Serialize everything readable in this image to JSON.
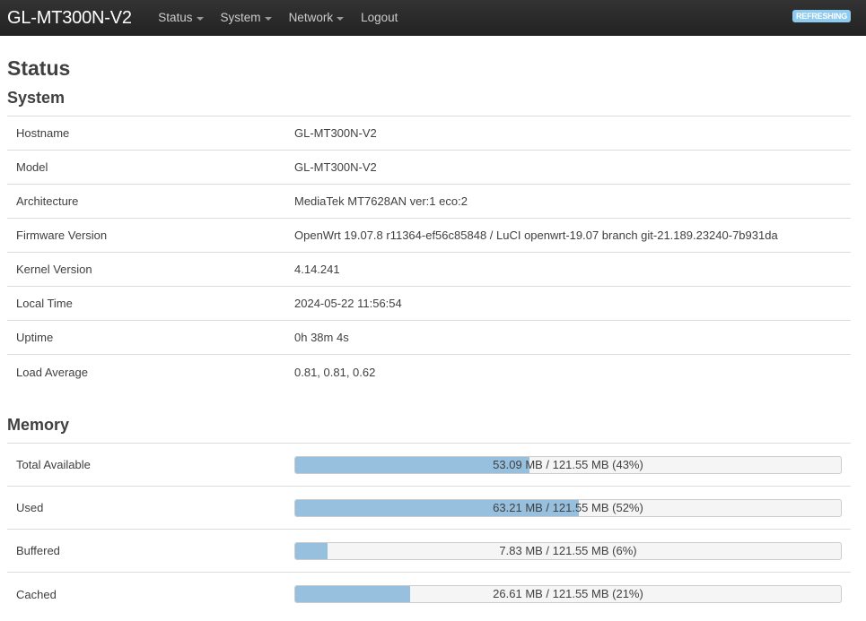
{
  "navbar": {
    "brand": "GL-MT300N-V2",
    "menu": [
      {
        "label": "Status",
        "dropdown": true
      },
      {
        "label": "System",
        "dropdown": true
      },
      {
        "label": "Network",
        "dropdown": true
      },
      {
        "label": "Logout",
        "dropdown": false
      }
    ],
    "indicator": "REFRESHING"
  },
  "page": {
    "title": "Status"
  },
  "system": {
    "heading": "System",
    "rows": [
      {
        "label": "Hostname",
        "value": "GL-MT300N-V2"
      },
      {
        "label": "Model",
        "value": "GL-MT300N-V2"
      },
      {
        "label": "Architecture",
        "value": "MediaTek MT7628AN ver:1 eco:2"
      },
      {
        "label": "Firmware Version",
        "value": "OpenWrt 19.07.8 r11364-ef56c85848 / LuCI openwrt-19.07 branch git-21.189.23240-7b931da"
      },
      {
        "label": "Kernel Version",
        "value": "4.14.241"
      },
      {
        "label": "Local Time",
        "value": "2024-05-22 11:56:54"
      },
      {
        "label": "Uptime",
        "value": "0h 38m 4s"
      },
      {
        "label": "Load Average",
        "value": "0.81, 0.81, 0.62"
      }
    ]
  },
  "memory": {
    "heading": "Memory",
    "rows": [
      {
        "label": "Total Available",
        "text": "53.09 MB / 121.55 MB (43%)",
        "percent": 43
      },
      {
        "label": "Used",
        "text": "63.21 MB / 121.55 MB (52%)",
        "percent": 52
      },
      {
        "label": "Buffered",
        "text": "7.83 MB / 121.55 MB (6%)",
        "percent": 6
      },
      {
        "label": "Cached",
        "text": "26.61 MB / 121.55 MB (21%)",
        "percent": 21
      }
    ]
  },
  "colors": {
    "navbar": "#222222",
    "bar_fill": "#97c0de",
    "indicator": "#8ecbee"
  }
}
